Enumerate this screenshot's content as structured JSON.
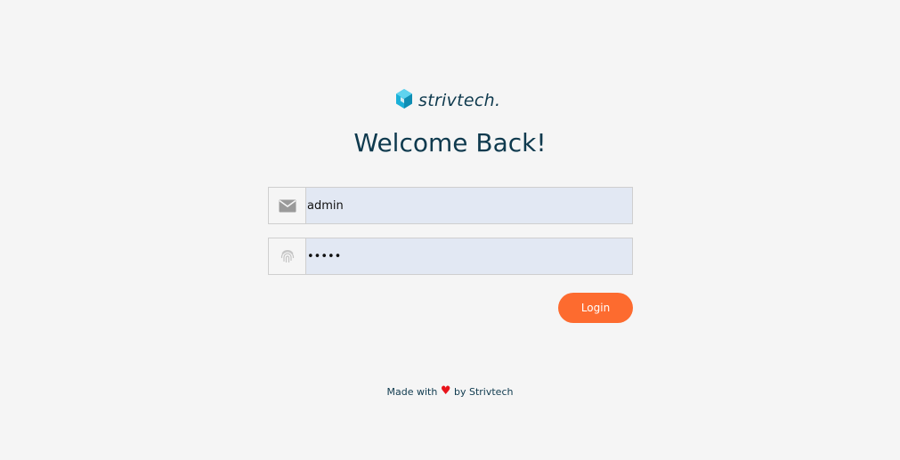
{
  "brand": {
    "name": "strivtech.",
    "logo_icon": "cube-hexagon-icon",
    "logo_color": "#1ab0d8"
  },
  "title": "Welcome Back!",
  "form": {
    "username": {
      "icon": "envelope-icon",
      "value": "admin"
    },
    "password": {
      "icon": "fingerprint-icon",
      "value": "admin"
    },
    "login_label": "Login",
    "login_color": "#fd6b2f"
  },
  "footer": {
    "prefix": "Made with",
    "heart": "♥",
    "suffix": "by Strivtech",
    "heart_color": "#e8141b"
  }
}
